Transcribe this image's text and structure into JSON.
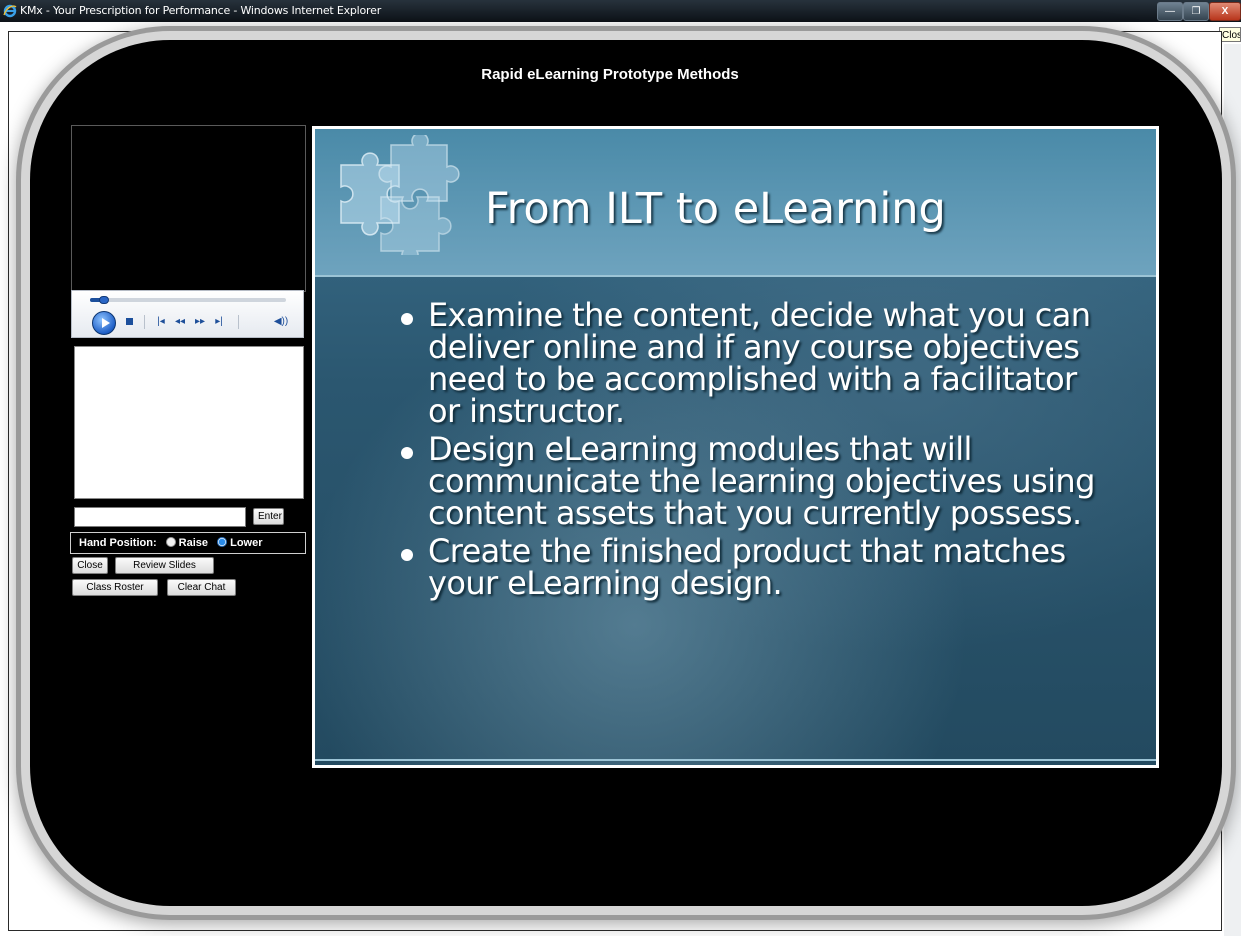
{
  "window": {
    "title": "KMx - Your Prescription for Performance - Windows Internet Explorer",
    "min_label": "—",
    "max_label": "❐",
    "close_label": "X",
    "tooltip": "Close"
  },
  "lesson": {
    "title": "Rapid eLearning Prototype Methods"
  },
  "player": {
    "progress": 0.07,
    "prev_label": "|◂",
    "rewind_label": "◂◂",
    "forward_label": "▸▸",
    "next_label": "▸|",
    "volume_icon": "speaker-icon",
    "volume_label": "◀))"
  },
  "chat": {
    "input_value": "",
    "enter_label": "Enter"
  },
  "hand": {
    "label": "Hand Position:",
    "raise_label": "Raise",
    "lower_label": "Lower",
    "selected": "Lower"
  },
  "buttons": {
    "close": "Close",
    "review_slides": "Review Slides",
    "class_roster": "Class Roster",
    "clear_chat": "Clear Chat"
  },
  "slide": {
    "title": "From ILT to eLearning",
    "bullets": [
      "Examine the content, decide what you can deliver online and if any course objectives need to be accomplished with a facilitator or instructor.",
      "Design eLearning modules that will communicate the learning objectives using content assets that you currently possess.",
      "Create the finished product that matches your eLearning design."
    ]
  },
  "colors": {
    "titlebar": "#0d1218",
    "shell": "#000000",
    "slide_header": "#5a95b2",
    "slide_body": "#2b5770",
    "accent": "#1f5fc7"
  }
}
